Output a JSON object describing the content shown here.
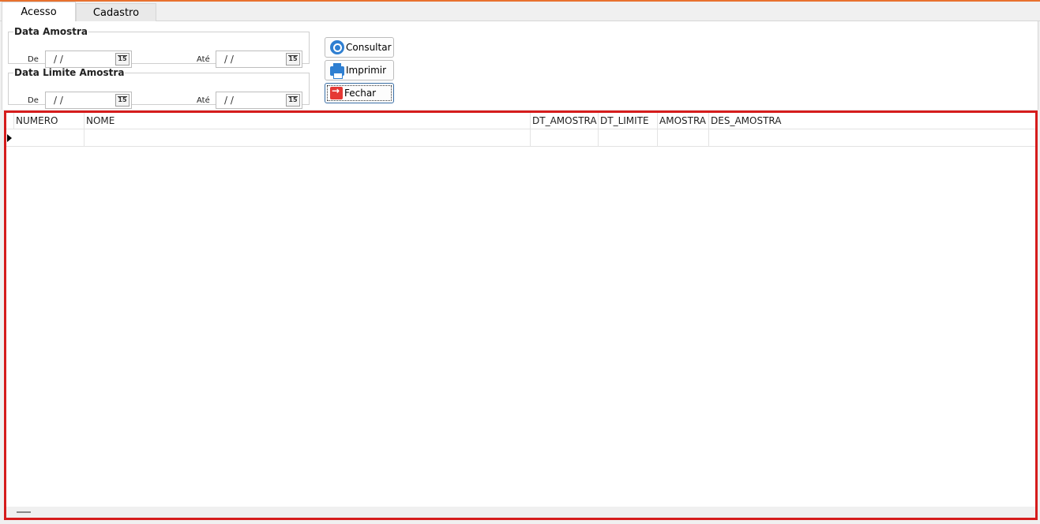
{
  "tabs": [
    {
      "label": "Acesso",
      "active": true
    },
    {
      "label": "Cadastro",
      "active": false
    }
  ],
  "filters": {
    "data_amostra": {
      "legend": "Data Amostra",
      "from_label": "De",
      "from_value": " /  /",
      "to_label": "Até",
      "to_value": " /  /"
    },
    "data_limite": {
      "legend": "Data Limite Amostra",
      "from_label": "De",
      "from_value": " /  /",
      "to_label": "Até",
      "to_value": " /  /"
    },
    "calendar_icon_text": "15"
  },
  "buttons": {
    "consultar": "Consultar",
    "imprimir": "Imprimir",
    "fechar": "Fechar"
  },
  "grid": {
    "columns": [
      "NUMERO",
      "NOME",
      "DT_AMOSTRA",
      "DT_LIMITE",
      "AMOSTRA",
      "DES_AMOSTRA"
    ],
    "highlight_color": "#d51c1c"
  },
  "colors": {
    "accent_top": "#e8712e",
    "icon_blue": "#2f7fd1",
    "icon_red": "#e53935"
  }
}
